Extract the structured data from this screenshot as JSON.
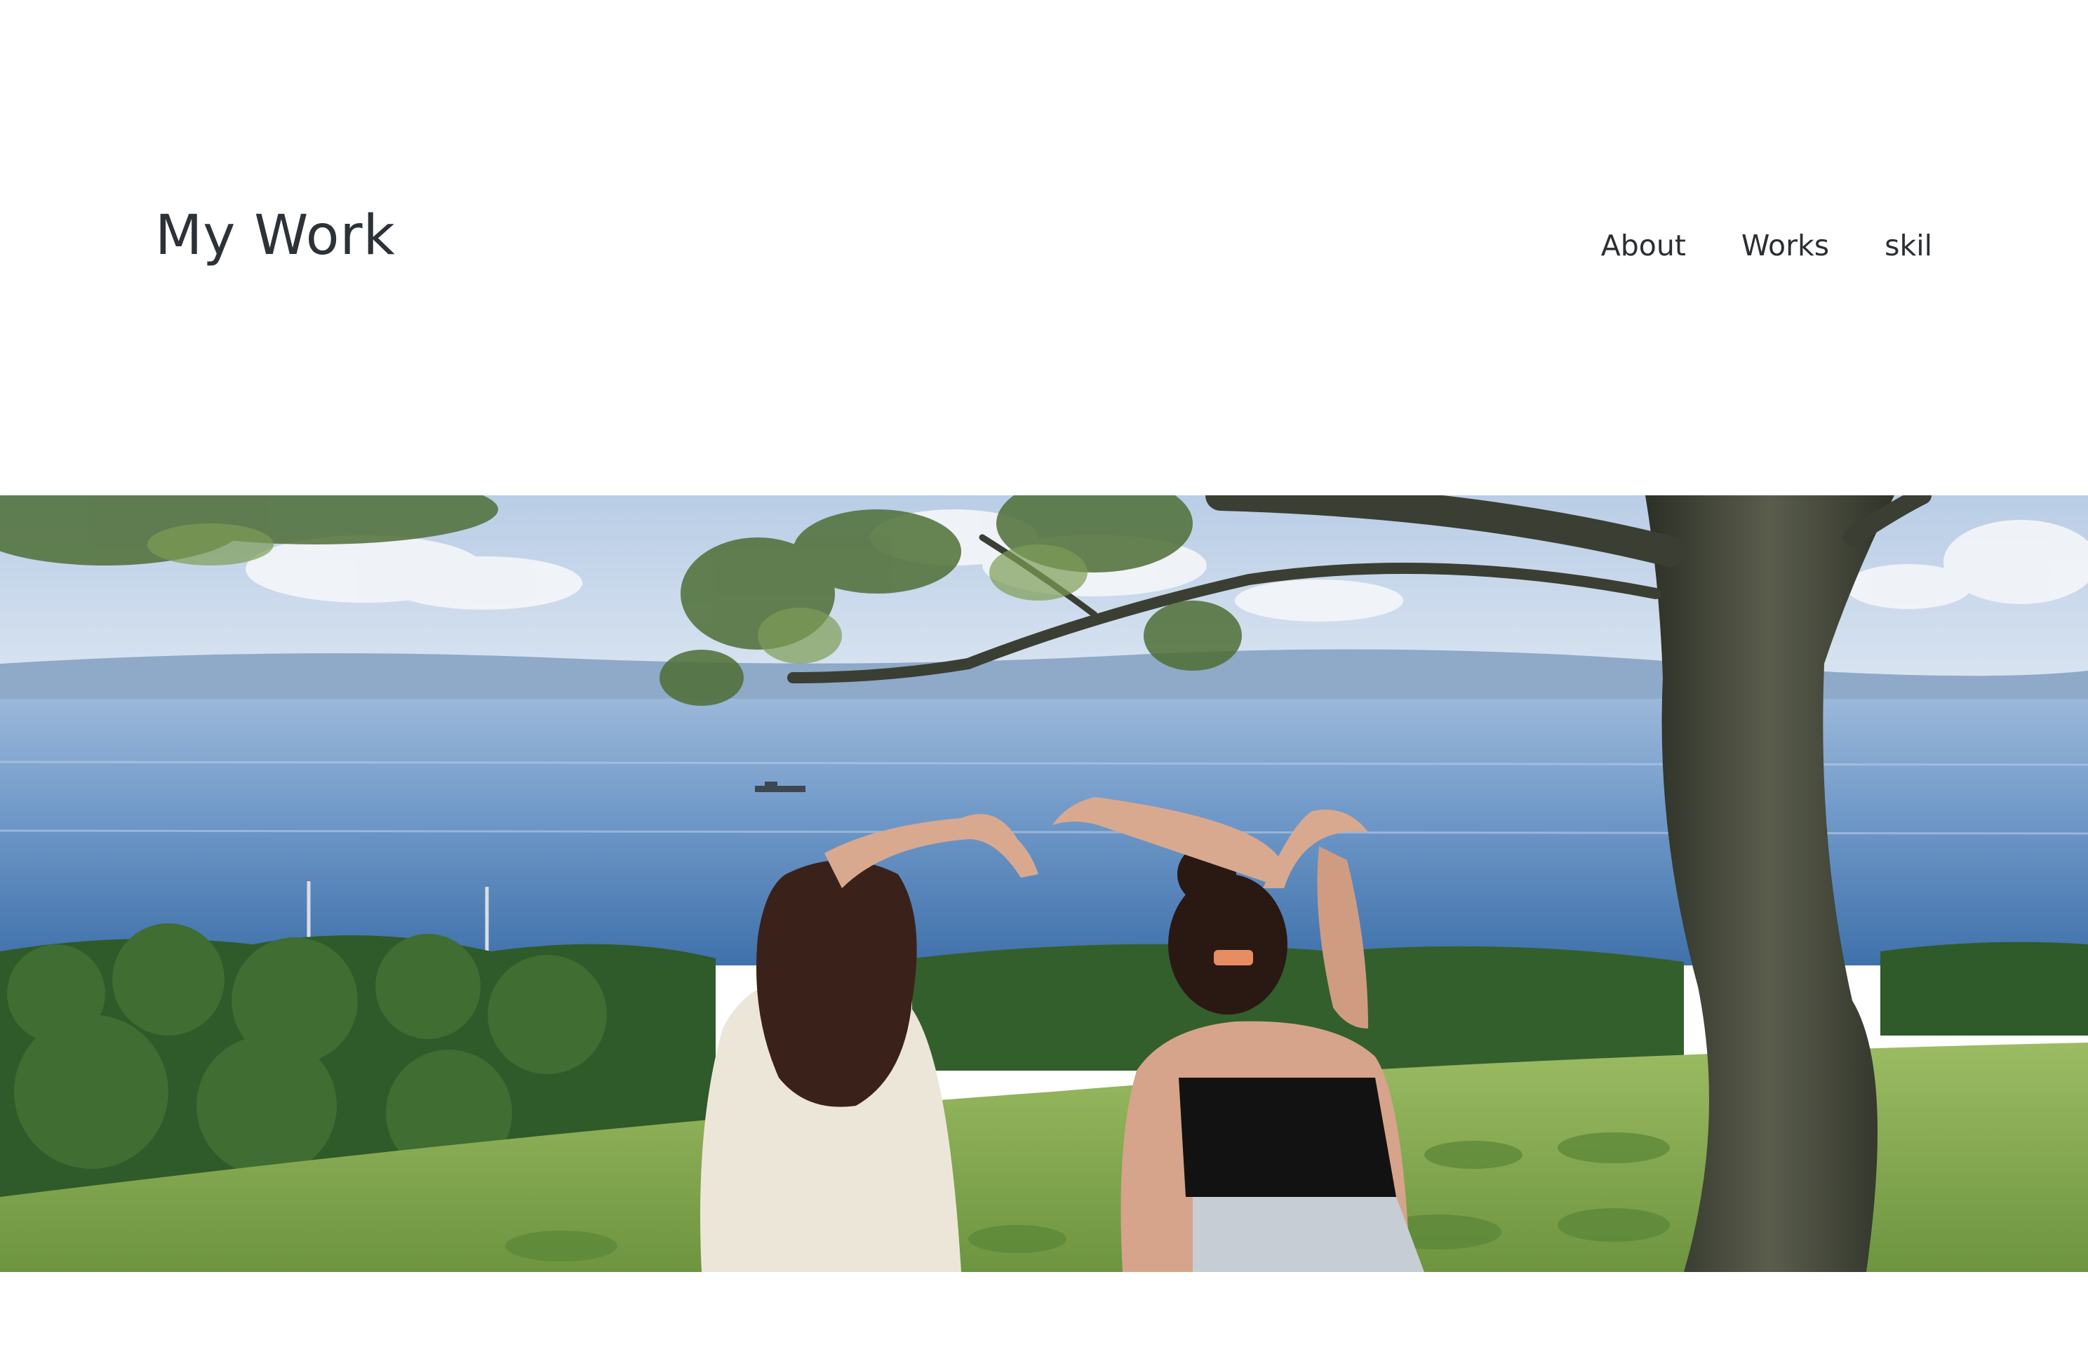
{
  "header": {
    "site_title": "My Work",
    "nav": [
      {
        "label": "About"
      },
      {
        "label": "Works"
      },
      {
        "label": "skil"
      }
    ]
  },
  "hero": {
    "colors": {
      "sky_top": "#c9d8ea",
      "sea": "#4d7fb8",
      "forest": "#2f5a2a",
      "field": "#7fa94e",
      "trunk": "#3e4235"
    }
  }
}
